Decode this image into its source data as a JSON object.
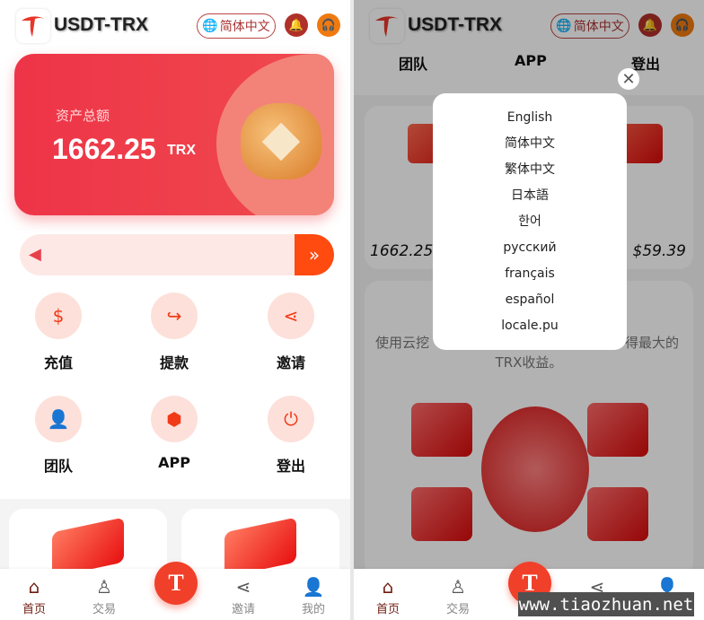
{
  "app": {
    "title": "USDT-TRX",
    "language": "简体中文"
  },
  "asset": {
    "label": "资产总额",
    "value": "1662.25",
    "unit": "TRX"
  },
  "grid": [
    {
      "label": "充值",
      "icon": "dollar-shield-icon"
    },
    {
      "label": "提款",
      "icon": "withdraw-arrow-icon"
    },
    {
      "label": "邀请",
      "icon": "share-icon"
    },
    {
      "label": "团队",
      "icon": "team-icon"
    },
    {
      "label": "APP",
      "icon": "cube-icon"
    },
    {
      "label": "登出",
      "icon": "power-icon"
    }
  ],
  "tabbar": [
    {
      "label": "首页",
      "icon": "home-icon"
    },
    {
      "label": "交易",
      "icon": "trade-icon"
    },
    {
      "label": "邀请",
      "icon": "share-icon"
    },
    {
      "label": "我的",
      "icon": "user-icon"
    }
  ],
  "right": {
    "nav": [
      "团队",
      "APP",
      "登出"
    ],
    "balance_trx": "1662.257",
    "balance_usd": "≈ $59.39",
    "desc_left": "使用云挖",
    "desc_right": "得最大的",
    "desc_line2": "TRX收益。"
  },
  "language_modal": {
    "options": [
      "English",
      "简体中文",
      "繁体中文",
      "日本語",
      "한어",
      "русский",
      "français",
      "español",
      "locale.pu"
    ]
  },
  "watermark": "www.tiaozhuan.net",
  "colors": {
    "brand": "#ee3448",
    "accent": "#ff4a10",
    "active_tab": "#6e1b10"
  }
}
